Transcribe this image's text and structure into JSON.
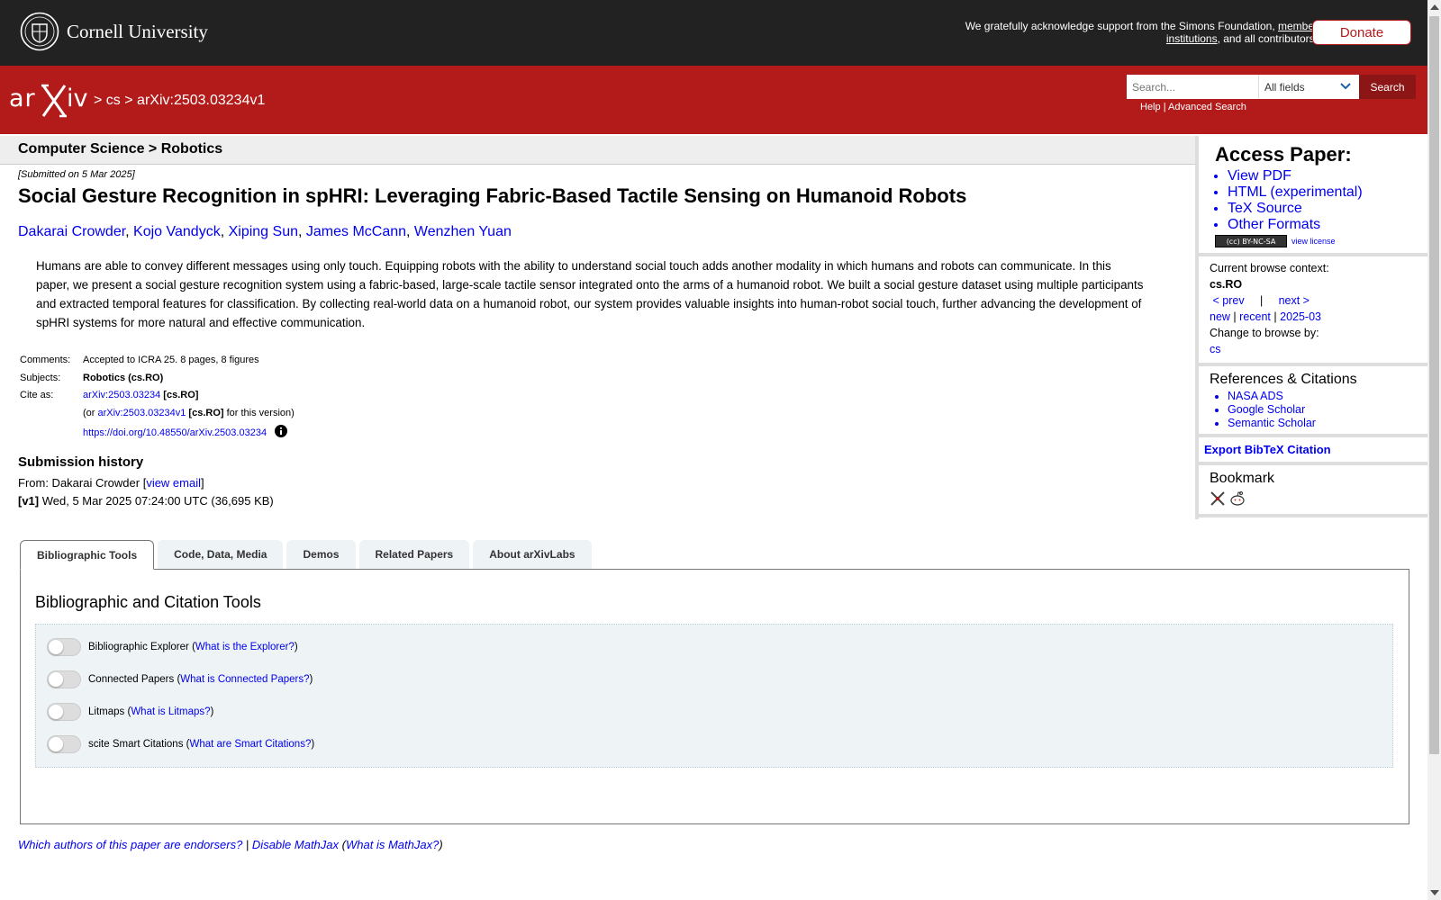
{
  "topbar": {
    "university": "Cornell University",
    "ack_prefix": "We gratefully acknowledge support from the Simons Foundation, ",
    "ack_link": "member institutions",
    "ack_suffix": ", and all contributors.",
    "donate": "Donate"
  },
  "header": {
    "crumb_sep1": ">",
    "crumb_cs": "cs",
    "crumb_sep2": ">",
    "crumb_id": "arXiv:2503.03234v1",
    "search_placeholder": "Search...",
    "search_field": "All fields",
    "search_button": "Search",
    "help": "Help",
    "help_sep": "|",
    "advanced": "Advanced Search"
  },
  "subheader": "Computer Science > Robotics",
  "paper": {
    "submitted": "[Submitted on 5 Mar 2025]",
    "title": "Social Gesture Recognition in spHRI: Leveraging Fabric-Based Tactile Sensing on Humanoid Robots",
    "authors": [
      "Dakarai Crowder",
      "Kojo Vandyck",
      "Xiping Sun",
      "James McCann",
      "Wenzhen Yuan"
    ],
    "author_sep": ", ",
    "abstract": "Humans are able to convey different messages using only touch. Equipping robots with the ability to understand social touch adds another modality in which humans and robots can communicate. In this paper, we present a social gesture recognition system using a fabric-based, large-scale tactile sensor integrated onto the arms of a humanoid robot. We built a social gesture dataset using multiple participants and extracted temporal features for classification. By collecting real-world data on a humanoid robot, our system provides valuable insights into human-robot social touch, further advancing the development of spHRI systems for more natural and effective communication."
  },
  "meta": {
    "comments_label": "Comments:",
    "comments": "Accepted to ICRA 25. 8 pages, 8 figures",
    "subjects_label": "Subjects:",
    "subjects": "Robotics (cs.RO)",
    "cite_label": "Cite as:",
    "cite_id": "arXiv:2503.03234",
    "cite_cat": "[cs.RO]",
    "cite_or": "(or ",
    "cite_version": "arXiv:2503.03234v1",
    "cite_version_cat": "[cs.RO]",
    "cite_version_suffix": " for this version)",
    "doi": "https://doi.org/10.48550/arXiv.2503.03234"
  },
  "history": {
    "title": "Submission history",
    "from_prefix": "From: Dakarai Crowder [",
    "view_email": "view email",
    "from_suffix": "]",
    "v1_label": "[v1]",
    "v1_text": " Wed, 5 Mar 2025 07:24:00 UTC (36,695 KB)"
  },
  "tabs": [
    "Bibliographic Tools",
    "Code, Data, Media",
    "Demos",
    "Related Papers",
    "About arXivLabs"
  ],
  "tools": {
    "heading": "Bibliographic and Citation Tools",
    "items": [
      {
        "name": "Bibliographic Explorer",
        "link": "What is the Explorer?"
      },
      {
        "name": "Connected Papers",
        "link": "What is Connected Papers?"
      },
      {
        "name": "Litmaps",
        "link": "What is Litmaps?"
      },
      {
        "name": "scite Smart Citations",
        "link": "What are Smart Citations?"
      }
    ]
  },
  "footer": {
    "endorsers": "Which authors of this paper are endorsers?",
    "sep": " | ",
    "disable_mathjax": "Disable MathJax",
    "what_mathjax": "What is MathJax?"
  },
  "sidebar": {
    "access_title": "Access Paper:",
    "access_links": [
      "View PDF",
      "HTML (experimental)",
      "TeX Source",
      "Other Formats"
    ],
    "license_badge": "(cc) BY-NC-SA",
    "view_license": "view license",
    "browse_context_label": "Current browse context:",
    "browse_context": "cs.RO",
    "prev": "< prev",
    "bar": "|",
    "next": "next >",
    "new": "new",
    "recent": "recent",
    "month": "2025-03",
    "change_browse": "Change to browse by:",
    "browse_cs": "cs",
    "refs_title": "References & Citations",
    "refs": [
      "NASA ADS",
      "Google Scholar",
      "Semantic Scholar"
    ],
    "bibtex": "Export BibTeX Citation",
    "bookmark": "Bookmark"
  },
  "colors": {
    "arxiv_red": "#b31b1b",
    "topbar": "#222222",
    "link": "#0000ee"
  }
}
